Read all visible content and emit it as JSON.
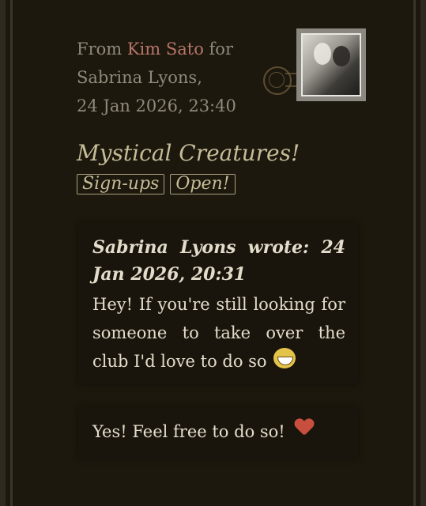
{
  "letter": {
    "from_label": "From",
    "sender": "Kim Sato",
    "for_label": "for",
    "recipient": "Sabrina Lyons,",
    "timestamp": "24 Jan 2026, 23:40",
    "subject": "Mystical Creatures!",
    "tags": [
      "Sign-ups",
      "Open!"
    ]
  },
  "quote": {
    "header": "Sabrina Lyons wrote: 24 Jan 2026, 20:31",
    "body": "Hey! If you're still looking for someone to take over the club I'd love to do so",
    "emoji": "laughing-emoji"
  },
  "reply": {
    "body": "Yes! Feel free to do so!",
    "emoji": "heart-emoji"
  },
  "colors": {
    "background": "#1d180d",
    "sender_name": "#b7756a",
    "subject": "#c5bc98",
    "body_text": "#e3dccb"
  }
}
